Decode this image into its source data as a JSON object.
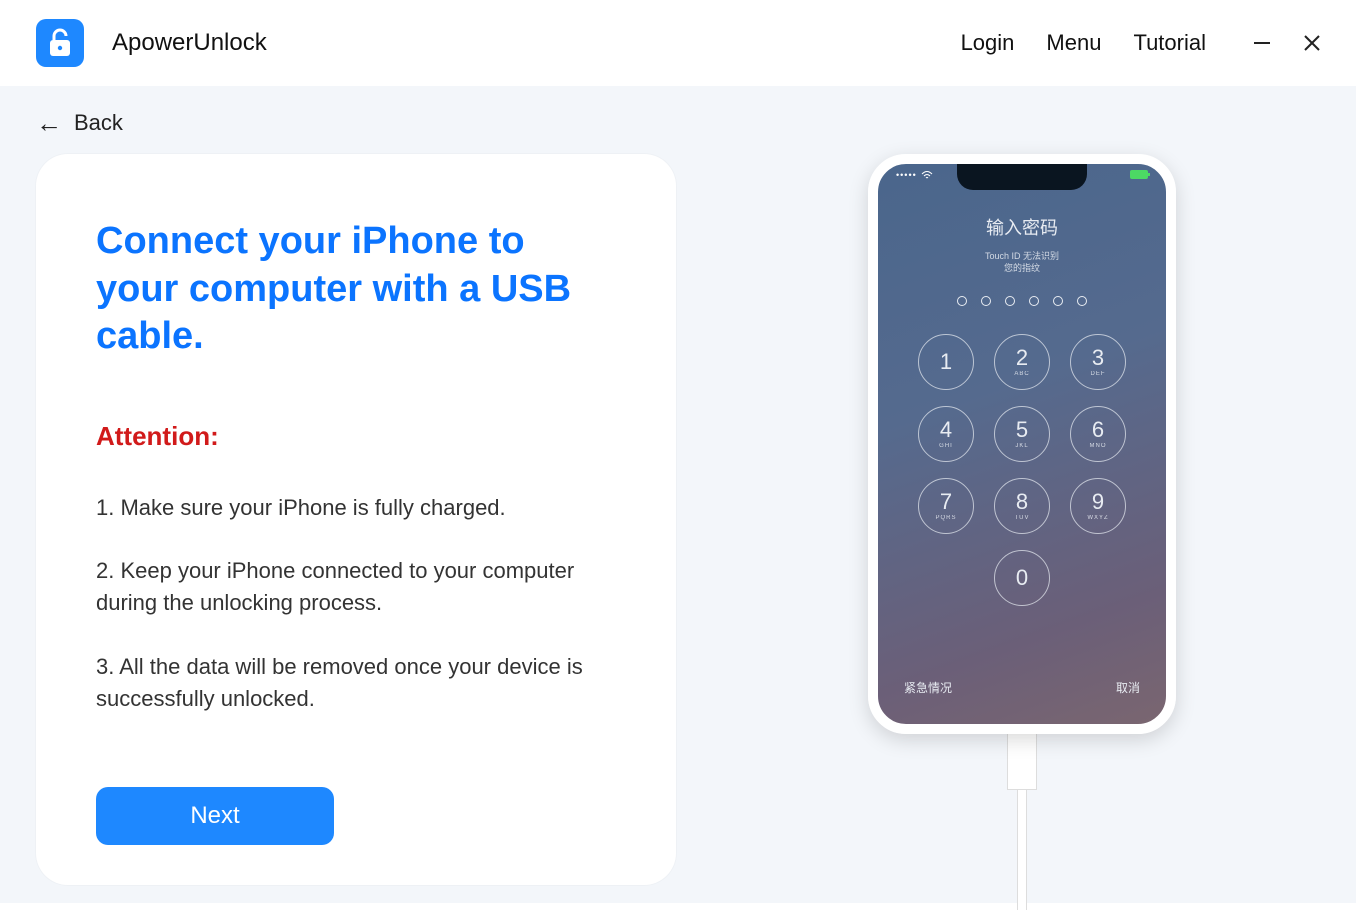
{
  "header": {
    "app_name": "ApowerUnlock",
    "links": {
      "login": "Login",
      "menu": "Menu",
      "tutorial": "Tutorial"
    }
  },
  "nav": {
    "back_label": "Back"
  },
  "card": {
    "title": "Connect your iPhone to your computer with a USB cable.",
    "attention_label": "Attention:",
    "items": [
      "1. Make sure your iPhone is fully charged.",
      "2. Keep your iPhone connected to your computer during the unlocking process.",
      "3. All the data will be removed once your device is successfully unlocked."
    ],
    "next_label": "Next"
  },
  "phone": {
    "lock_title": "输入密码",
    "lock_sub_line1": "Touch ID 无法识别",
    "lock_sub_line2": "您的指纹",
    "keys": [
      {
        "n": "1",
        "s": ""
      },
      {
        "n": "2",
        "s": "ABC"
      },
      {
        "n": "3",
        "s": "DEF"
      },
      {
        "n": "4",
        "s": "GHI"
      },
      {
        "n": "5",
        "s": "JKL"
      },
      {
        "n": "6",
        "s": "MNO"
      },
      {
        "n": "7",
        "s": "PQRS"
      },
      {
        "n": "8",
        "s": "TUV"
      },
      {
        "n": "9",
        "s": "WXYZ"
      },
      {
        "n": "",
        "s": ""
      },
      {
        "n": "0",
        "s": ""
      },
      {
        "n": "",
        "s": ""
      }
    ],
    "bottom_left": "紧急情况",
    "bottom_right": "取消"
  }
}
